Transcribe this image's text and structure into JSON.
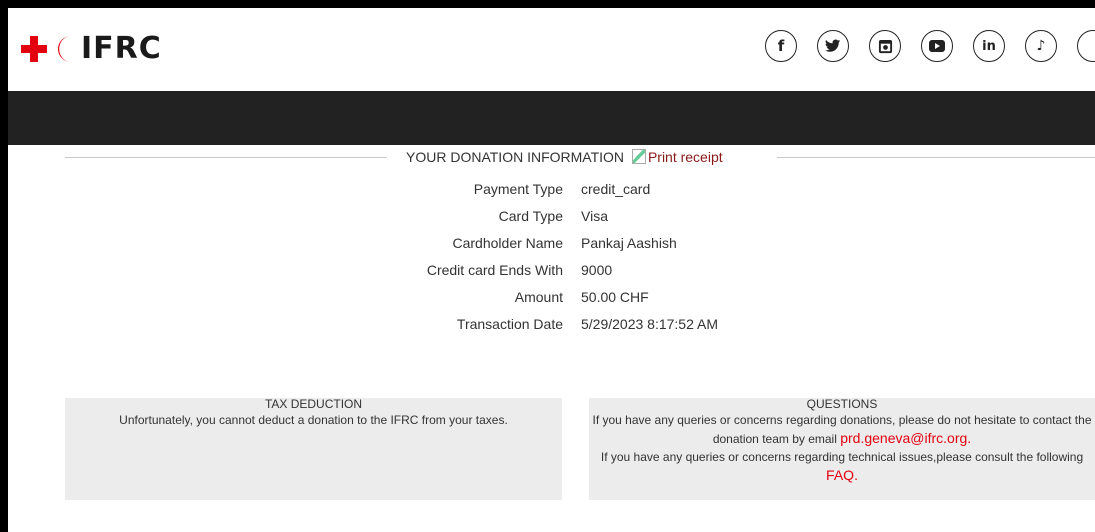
{
  "brand": {
    "logo_text": "IFRC",
    "accent_color": "#e3000f"
  },
  "header": {
    "socials": [
      {
        "name": "facebook-icon",
        "glyph": "f"
      },
      {
        "name": "twitter-icon"
      },
      {
        "name": "instagram-icon"
      },
      {
        "name": "youtube-icon"
      },
      {
        "name": "linkedin-icon",
        "glyph": "in"
      },
      {
        "name": "tiktok-icon",
        "glyph": "♪"
      },
      {
        "name": "more-social-icon"
      }
    ]
  },
  "donation": {
    "section_title": "YOUR DONATION INFORMATION",
    "print_label": "Print receipt",
    "rows": [
      {
        "label": "Payment Type",
        "value": "credit_card"
      },
      {
        "label": "Card Type",
        "value": "Visa"
      },
      {
        "label": "Cardholder Name",
        "value": "Pankaj Aashish"
      },
      {
        "label": "Credit card Ends With",
        "value": "9000"
      },
      {
        "label": "Amount",
        "value": "50.00 CHF"
      },
      {
        "label": "Transaction Date",
        "value": "5/29/2023 8:17:52 AM"
      }
    ]
  },
  "tax": {
    "title": "TAX DEDUCTION",
    "body": "Unfortunately, you cannot deduct a donation to the IFRC from your taxes."
  },
  "questions": {
    "title": "QUESTIONS",
    "line1": "If you have any queries or concerns regarding donations, please do not hesitate to contact the donation team by email ",
    "email": "prd.geneva@ifrc.org",
    "line1_end": ".",
    "line2": "If you have any queries or concerns regarding technical issues,please consult the following ",
    "faq": "FAQ",
    "line2_end": "."
  }
}
